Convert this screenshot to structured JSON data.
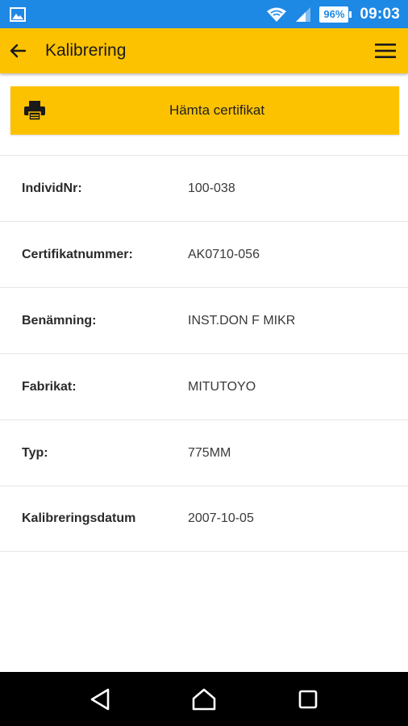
{
  "status_bar": {
    "time": "09:03",
    "battery": "96%",
    "icons": [
      "gallery-icon",
      "wifi-icon",
      "signal-icon",
      "battery-icon"
    ],
    "color": "#1e88e5"
  },
  "app_bar": {
    "title": "Kalibrering",
    "back_icon": "arrow-left-icon",
    "menu_icon": "hamburger-menu-icon",
    "color": "#fcc200"
  },
  "actions": {
    "certificate_label": "Hämta certifikat",
    "certificate_icon": "printer-icon"
  },
  "details": [
    {
      "label": "IndividNr:",
      "value": "100-038"
    },
    {
      "label": "Certifikatnummer:",
      "value": "AK0710-056"
    },
    {
      "label": "Benämning:",
      "value": "INST.DON F MIKR"
    },
    {
      "label": "Fabrikat:",
      "value": "MITUTOYO"
    },
    {
      "label": "Typ:",
      "value": "775MM"
    },
    {
      "label": "Kalibreringsdatum",
      "value": "2007-10-05"
    }
  ],
  "nav_bar": {
    "icons": [
      "back-triangle-icon",
      "home-icon",
      "recents-square-icon"
    ]
  }
}
